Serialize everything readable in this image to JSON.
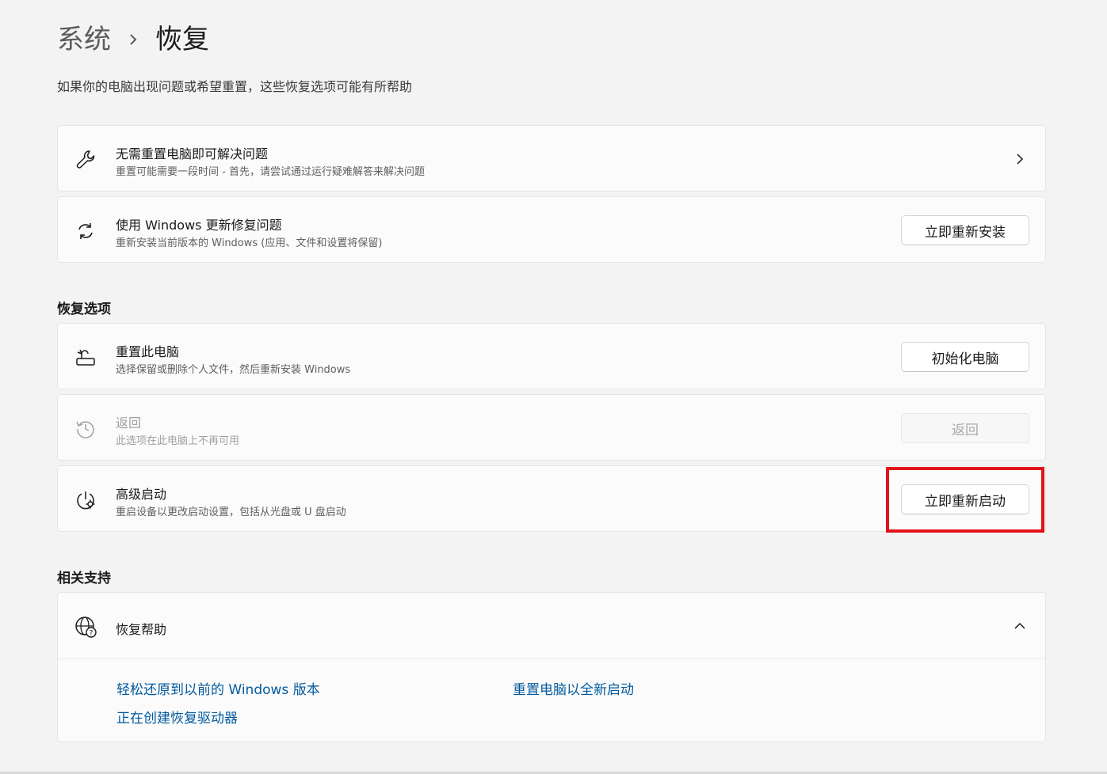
{
  "breadcrumb": {
    "parent": "系统",
    "separator_icon": "chevron-right-icon",
    "current": "恢复"
  },
  "subtitle": "如果你的电脑出现问题或希望重置，这些恢复选项可能有所帮助",
  "top_cards": [
    {
      "icon": "wrench-icon",
      "title": "无需重置电脑即可解决问题",
      "desc": "重置可能需要一段时间 - 首先，请尝试通过运行疑难解答来解决问题",
      "action_icon": "chevron-right-icon"
    },
    {
      "icon": "refresh-icon",
      "title": "使用 Windows 更新修复问题",
      "desc": "重新安装当前版本的 Windows (应用、文件和设置将保留)",
      "button": "立即重新安装"
    }
  ],
  "recovery_section": {
    "title": "恢复选项",
    "items": [
      {
        "icon": "reset-pc-icon",
        "title": "重置此电脑",
        "desc": "选择保留或删除个人文件，然后重新安装 Windows",
        "button": "初始化电脑",
        "enabled": true
      },
      {
        "icon": "history-icon",
        "title": "返回",
        "desc": "此选项在此电脑上不再可用",
        "button": "返回",
        "enabled": false
      },
      {
        "icon": "advanced-startup-icon",
        "title": "高级启动",
        "desc": "重启设备以更改启动设置，包括从光盘或 U 盘启动",
        "button": "立即重新启动",
        "enabled": true,
        "highlighted": true
      }
    ]
  },
  "support_section": {
    "title": "相关支持",
    "expander": {
      "icon": "globe-help-icon",
      "title": "恢复帮助",
      "state_icon": "chevron-up-icon",
      "links": [
        "轻松还原到以前的 Windows 版本",
        "重置电脑以全新启动",
        "正在创建恢复驱动器"
      ]
    }
  },
  "colors": {
    "background": "#f3f3f3",
    "card": "#fbfbfb",
    "link": "#005a9e",
    "highlight": "#e0121b"
  }
}
